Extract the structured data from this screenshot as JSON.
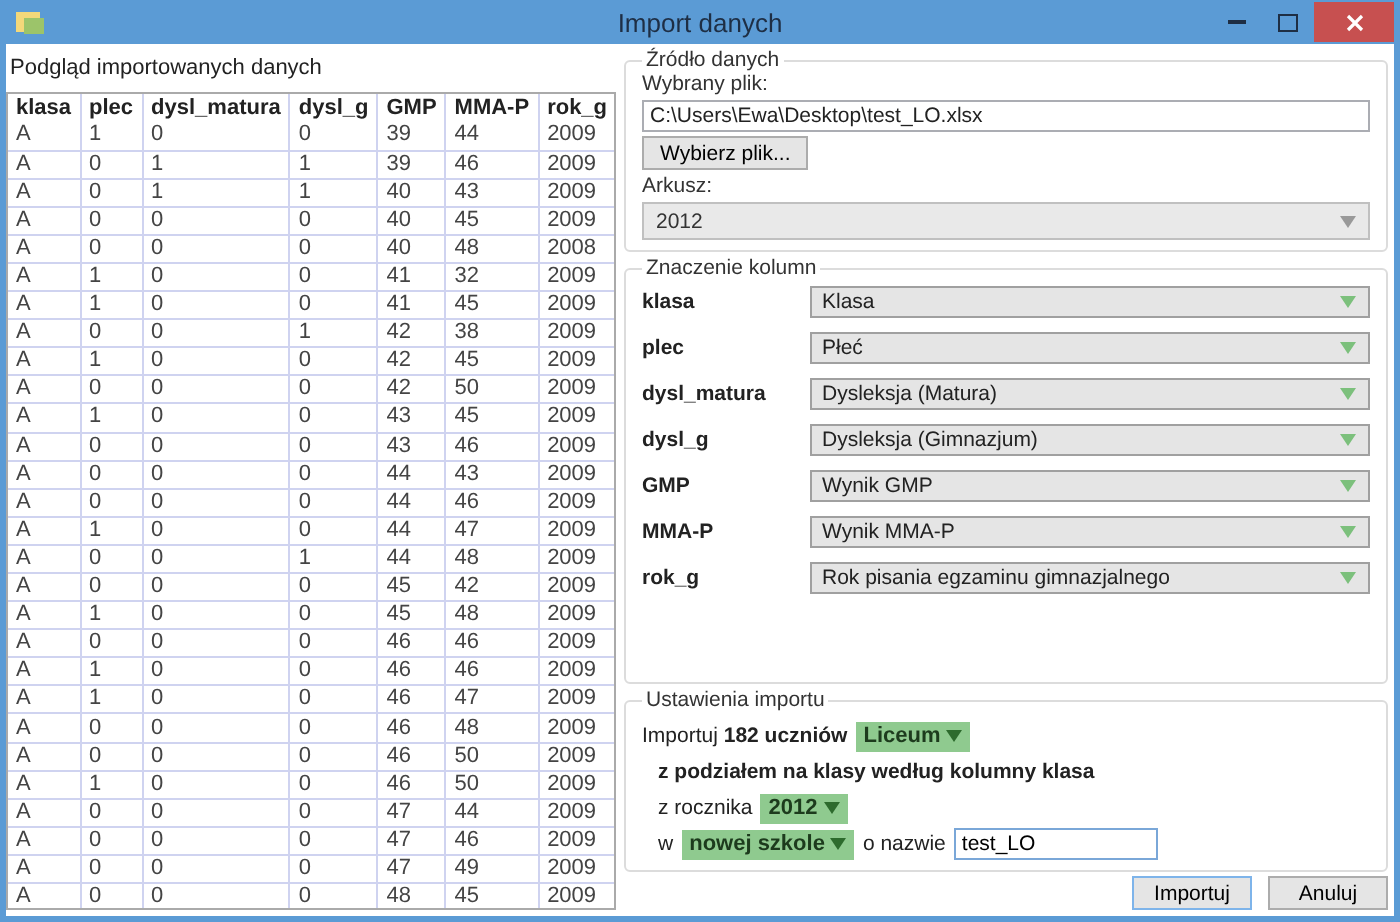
{
  "window": {
    "title": "Import danych"
  },
  "preview": {
    "title": "Podgląd importowanych danych",
    "columns": [
      "klasa",
      "plec",
      "dysl_matura",
      "dysl_g",
      "GMP",
      "MMA-P",
      "rok_g"
    ],
    "rows": [
      [
        "A",
        "1",
        "0",
        "0",
        "39",
        "44",
        "2009"
      ],
      [
        "A",
        "0",
        "1",
        "1",
        "39",
        "46",
        "2009"
      ],
      [
        "A",
        "0",
        "1",
        "1",
        "40",
        "43",
        "2009"
      ],
      [
        "A",
        "0",
        "0",
        "0",
        "40",
        "45",
        "2009"
      ],
      [
        "A",
        "0",
        "0",
        "0",
        "40",
        "48",
        "2008"
      ],
      [
        "A",
        "1",
        "0",
        "0",
        "41",
        "32",
        "2009"
      ],
      [
        "A",
        "1",
        "0",
        "0",
        "41",
        "45",
        "2009"
      ],
      [
        "A",
        "0",
        "0",
        "1",
        "42",
        "38",
        "2009"
      ],
      [
        "A",
        "1",
        "0",
        "0",
        "42",
        "45",
        "2009"
      ],
      [
        "A",
        "0",
        "0",
        "0",
        "42",
        "50",
        "2009"
      ],
      [
        "A",
        "1",
        "0",
        "0",
        "43",
        "45",
        "2009"
      ],
      [
        "A",
        "0",
        "0",
        "0",
        "43",
        "46",
        "2009"
      ],
      [
        "A",
        "0",
        "0",
        "0",
        "44",
        "43",
        "2009"
      ],
      [
        "A",
        "0",
        "0",
        "0",
        "44",
        "46",
        "2009"
      ],
      [
        "A",
        "1",
        "0",
        "0",
        "44",
        "47",
        "2009"
      ],
      [
        "A",
        "0",
        "0",
        "1",
        "44",
        "48",
        "2009"
      ],
      [
        "A",
        "0",
        "0",
        "0",
        "45",
        "42",
        "2009"
      ],
      [
        "A",
        "1",
        "0",
        "0",
        "45",
        "48",
        "2009"
      ],
      [
        "A",
        "0",
        "0",
        "0",
        "46",
        "46",
        "2009"
      ],
      [
        "A",
        "1",
        "0",
        "0",
        "46",
        "46",
        "2009"
      ],
      [
        "A",
        "1",
        "0",
        "0",
        "46",
        "47",
        "2009"
      ],
      [
        "A",
        "0",
        "0",
        "0",
        "46",
        "48",
        "2009"
      ],
      [
        "A",
        "0",
        "0",
        "0",
        "46",
        "50",
        "2009"
      ],
      [
        "A",
        "1",
        "0",
        "0",
        "46",
        "50",
        "2009"
      ],
      [
        "A",
        "0",
        "0",
        "0",
        "47",
        "44",
        "2009"
      ],
      [
        "A",
        "0",
        "0",
        "0",
        "47",
        "46",
        "2009"
      ],
      [
        "A",
        "0",
        "0",
        "0",
        "47",
        "49",
        "2009"
      ],
      [
        "A",
        "0",
        "0",
        "0",
        "48",
        "45",
        "2009"
      ]
    ]
  },
  "source": {
    "title": "Źródło danych",
    "file_label": "Wybrany plik:",
    "file_value": "C:\\Users\\Ewa\\Desktop\\test_LO.xlsx",
    "choose_button": "Wybierz plik...",
    "sheet_label": "Arkusz:",
    "sheet_value": "2012"
  },
  "mapping": {
    "title": "Znaczenie kolumn",
    "items": [
      {
        "column": "klasa",
        "meaning": "Klasa"
      },
      {
        "column": "plec",
        "meaning": "Płeć"
      },
      {
        "column": "dysl_matura",
        "meaning": "Dysleksja (Matura)"
      },
      {
        "column": "dysl_g",
        "meaning": "Dysleksja (Gimnazjum)"
      },
      {
        "column": "GMP",
        "meaning": "Wynik GMP"
      },
      {
        "column": "MMA-P",
        "meaning": "Wynik MMA-P"
      },
      {
        "column": "rok_g",
        "meaning": "Rok pisania egzaminu gimnazjalnego"
      }
    ]
  },
  "settings": {
    "title": "Ustawienia importu",
    "import_text": "Importuj **182 uczniów**",
    "school_type": "Liceum",
    "split_text": "z podziałem na klasy według kolumny klasa",
    "year_label": "z rocznika",
    "year": "2012",
    "in_label": "w",
    "school_target": "nowej szkole",
    "name_label": "o nazwie",
    "name_value": "test_LO"
  },
  "buttons": [
    "Importuj",
    "Anuluj"
  ]
}
